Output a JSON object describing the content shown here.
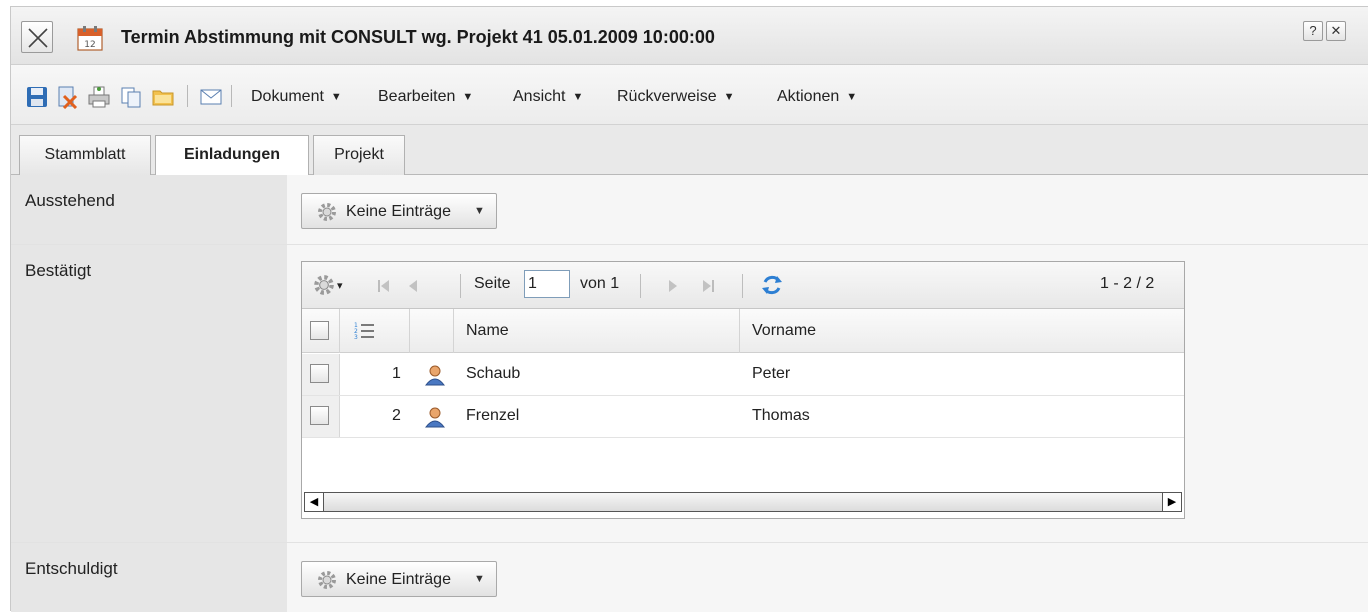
{
  "window": {
    "title": "Termin Abstimmung mit CONSULT wg. Projekt 41 05.01.2009 10:00:00",
    "help_label": "?",
    "close_label": "✕"
  },
  "toolbar": {
    "menus": [
      {
        "label": "Dokument",
        "arrow": "▼"
      },
      {
        "label": "Bearbeiten",
        "arrow": "▼"
      },
      {
        "label": "Ansicht",
        "arrow": "▼"
      },
      {
        "label": "Rückverweise",
        "arrow": "▼"
      },
      {
        "label": "Aktionen",
        "arrow": "▼"
      }
    ]
  },
  "tabs": [
    {
      "label": "Stammblatt"
    },
    {
      "label": "Einladungen",
      "active": true
    },
    {
      "label": "Projekt"
    }
  ],
  "sections": {
    "ausstehend": {
      "label": "Ausstehend",
      "button": "Keine Einträge",
      "arrow": "▼"
    },
    "bestaetigt": {
      "label": "Bestätigt"
    },
    "entschuldigt": {
      "label": "Entschuldigt",
      "button": "Keine Einträge",
      "arrow": "▼"
    }
  },
  "grid": {
    "pager": {
      "page_label": "Seite",
      "page_value": "1",
      "of_label": "von 1",
      "range": "1 - 2 / 2",
      "gear_arrow": "▾"
    },
    "columns": {
      "name": "Name",
      "vorname": "Vorname"
    },
    "rows": [
      {
        "num": "1",
        "name": "Schaub",
        "vorname": "Peter"
      },
      {
        "num": "2",
        "name": "Frenzel",
        "vorname": "Thomas"
      }
    ],
    "scroll_left": "◀",
    "scroll_right": "▶"
  }
}
